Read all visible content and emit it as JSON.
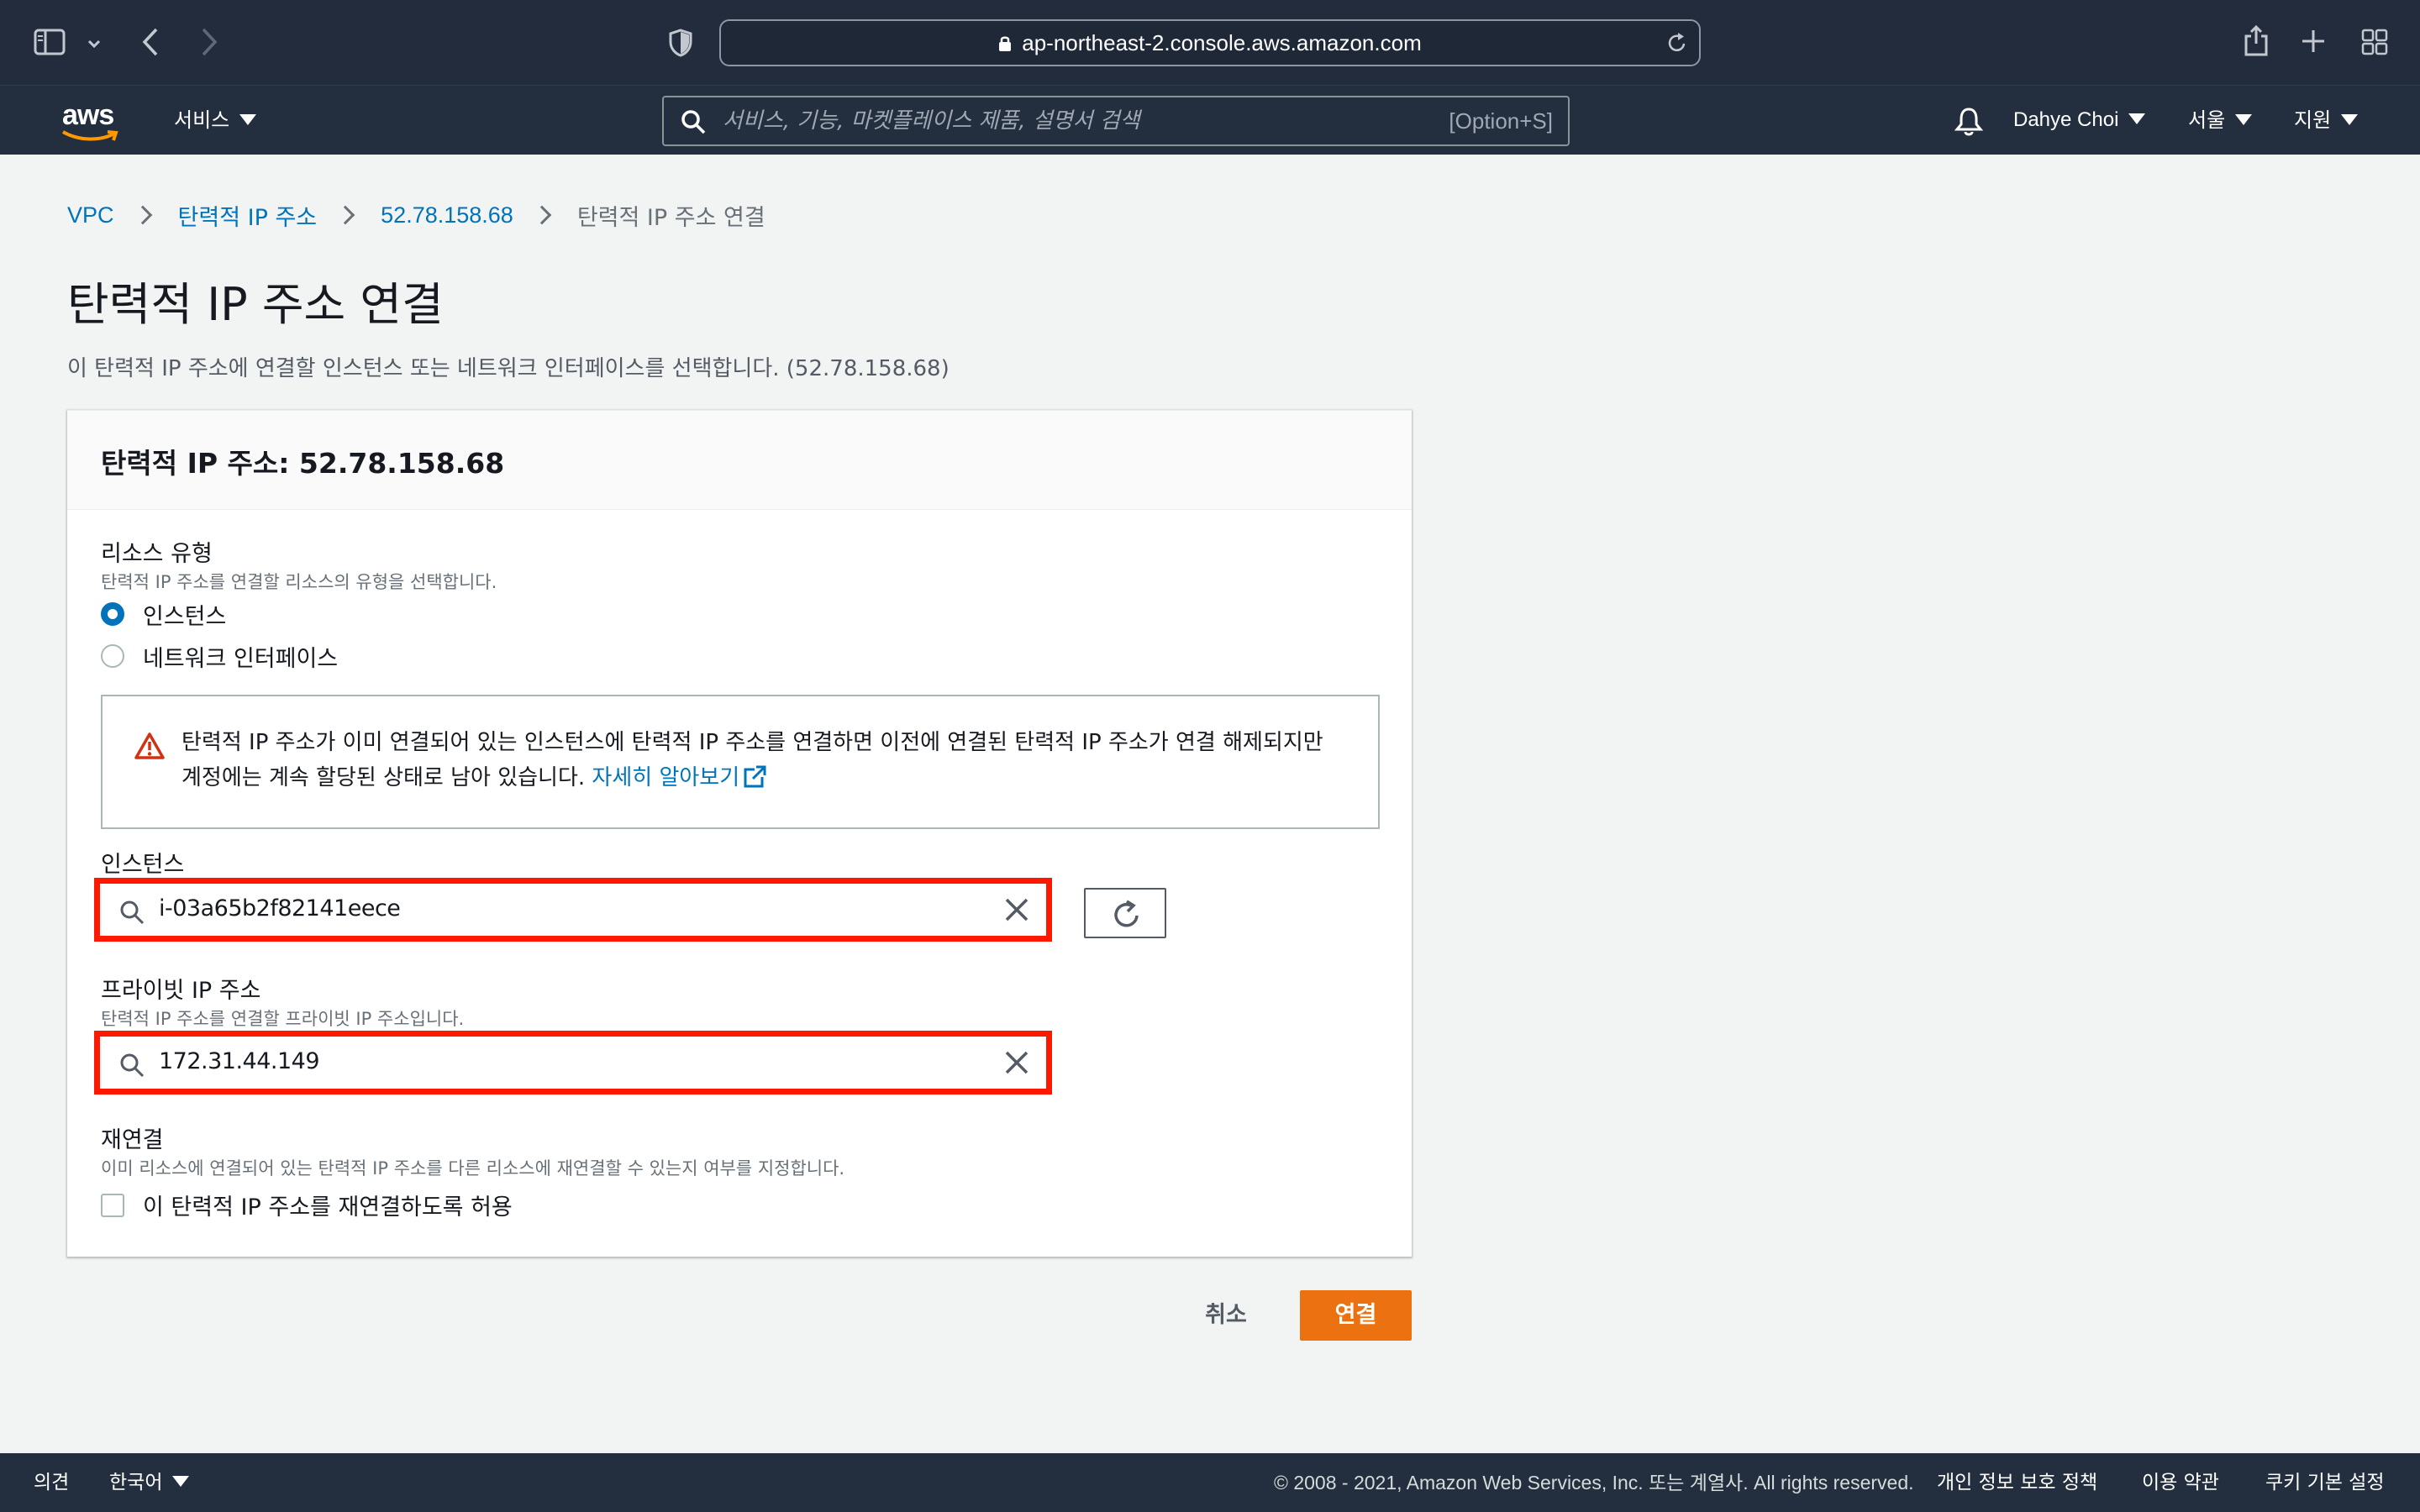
{
  "browser": {
    "url": "ap-northeast-2.console.aws.amazon.com"
  },
  "aws_nav": {
    "logo": "aws",
    "services_label": "서비스",
    "search_placeholder": "서비스, 기능, 마켓플레이스 제품, 설명서 검색",
    "search_shortcut": "[Option+S]",
    "user_name": "Dahye Choi",
    "region": "서울",
    "support": "지원"
  },
  "breadcrumb": {
    "items": [
      "VPC",
      "탄력적 IP 주소",
      "52.78.158.68"
    ],
    "current": "탄력적 IP 주소 연결"
  },
  "page": {
    "title": "탄력적 IP 주소 연결",
    "description": "이 탄력적 IP 주소에 연결할 인스턴스 또는 네트워크 인터페이스를 선택합니다. (52.78.158.68)"
  },
  "panel": {
    "header": "탄력적 IP 주소: 52.78.158.68",
    "resource_type": {
      "label": "리소스 유형",
      "description": "탄력적 IP 주소를 연결할 리소스의 유형을 선택합니다.",
      "options": [
        "인스턴스",
        "네트워크 인터페이스"
      ],
      "selected": "인스턴스"
    },
    "alert": {
      "line1": "탄력적 IP 주소가 이미 연결되어 있는 인스턴스에 탄력적 IP 주소를 연결하면 이전에 연결된 탄력적 IP 주소가 연결 해제되지만",
      "line2": "계정에는 계속 할당된 상태로 남아 있습니다.",
      "link": "자세히 알아보기"
    },
    "instance": {
      "label": "인스턴스",
      "value": "i-03a65b2f82141eece"
    },
    "private_ip": {
      "label": "프라이빗 IP 주소",
      "description": "탄력적 IP 주소를 연결할 프라이빗 IP 주소입니다.",
      "value": "172.31.44.149"
    },
    "reassociation": {
      "label": "재연결",
      "description": "이미 리소스에 연결되어 있는 탄력적 IP 주소를 다른 리소스에 재연결할 수 있는지 여부를 지정합니다.",
      "checkbox_label": "이 탄력적 IP 주소를 재연결하도록 허용",
      "checked": false
    }
  },
  "actions": {
    "cancel": "취소",
    "associate": "연결"
  },
  "footer": {
    "feedback": "의견",
    "language": "한국어",
    "copyright": "© 2008 - 2021, Amazon Web Services, Inc. 또는 계열사. All rights reserved.",
    "privacy": "개인 정보 보호 정책",
    "terms": "이용 약관",
    "cookies": "쿠키 기본 설정"
  },
  "colors": {
    "nav_bg": "#232f3e",
    "link": "#0073bb",
    "primary_button": "#ec7211",
    "highlight": "#ff1800",
    "warning": "#d13212"
  }
}
